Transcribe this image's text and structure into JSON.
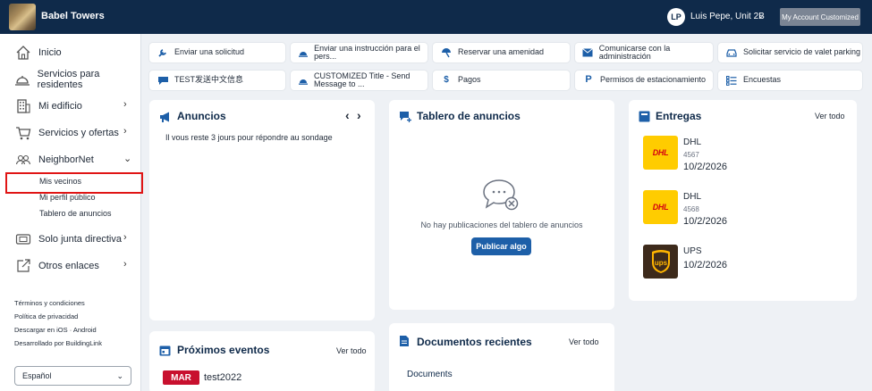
{
  "header": {
    "building_name": "Babel Towers",
    "avatar_initials": "LP",
    "user_label": "Luis Pepe, Unit 2B",
    "account_button": "My Account Customized"
  },
  "sidebar": {
    "items": [
      {
        "label": "Inicio",
        "icon": "house-icon"
      },
      {
        "label": "Servicios para residentes",
        "icon": "concierge-bell-icon"
      },
      {
        "label": "Mi edificio",
        "icon": "building-icon"
      },
      {
        "label": "Servicios y ofertas",
        "icon": "cart-icon"
      },
      {
        "label": "NeighborNet",
        "icon": "people-icon"
      },
      {
        "label": "Solo junta directiva",
        "icon": "folder-icon"
      },
      {
        "label": "Otros enlaces",
        "icon": "external-link-icon"
      }
    ],
    "neighbornet_sub": [
      "Mis vecinos",
      "Mi perfil público",
      "Tablero de anuncios"
    ],
    "footer_links": [
      "Términos y condiciones",
      "Política de privacidad",
      "Descargar en iOS · Android",
      "Desarrollado por BuildingLink"
    ],
    "language": "Español"
  },
  "quick_actions": [
    {
      "label": "Enviar una solicitud",
      "icon": "wrench-icon"
    },
    {
      "label": "Enviar una instrucción para el pers...",
      "icon": "bell-icon"
    },
    {
      "label": "Reservar una amenidad",
      "icon": "umbrella-icon"
    },
    {
      "label": "Comunicarse con la administración",
      "icon": "mail-icon"
    },
    {
      "label": "Solicitar servicio de valet parking",
      "icon": "car-icon"
    },
    {
      "label": "TEST发送中文信息",
      "icon": "chat-icon"
    },
    {
      "label": "CUSTOMIZED Title - Send Message to ...",
      "icon": "bell-icon"
    },
    {
      "label": "Pagos",
      "icon": "dollar-icon"
    },
    {
      "label": "Permisos de estacionamiento",
      "icon": "parking-icon"
    },
    {
      "label": "Encuestas",
      "icon": "list-icon"
    }
  ],
  "anuncios": {
    "title": "Anuncios",
    "message": "Il vous reste 3 jours pour répondre au sondage"
  },
  "tablero": {
    "title": "Tablero de anuncios",
    "empty": "No hay publicaciones del tablero de anuncios",
    "button": "Publicar algo"
  },
  "entregas": {
    "title": "Entregas",
    "see_all": "Ver todo",
    "items": [
      {
        "carrier": "DHL",
        "logo_text": "DHL",
        "tracking": "4567",
        "date": "10/2/2026"
      },
      {
        "carrier": "DHL",
        "logo_text": "DHL",
        "tracking": "4568",
        "date": "10/2/2026"
      },
      {
        "carrier": "UPS",
        "logo_text": "ups",
        "tracking": "",
        "date": "10/2/2026"
      }
    ]
  },
  "eventos": {
    "title": "Próximos eventos",
    "see_all": "Ver todo",
    "month": "MAR",
    "event_name": "test2022"
  },
  "documentos": {
    "title": "Documentos recientes",
    "see_all": "Ver todo",
    "first": "Documents"
  },
  "colors": {
    "navy": "#0f2a4a",
    "accent": "#1d5fa8",
    "highlight": "#e01515",
    "dhl_yellow": "#ffcc00",
    "dhl_red": "#d40511",
    "ups_brown": "#3d2a1b"
  }
}
